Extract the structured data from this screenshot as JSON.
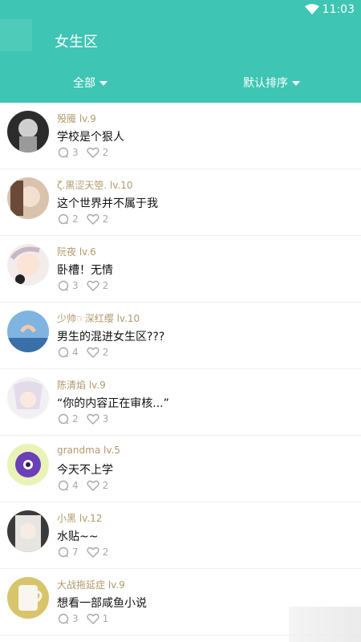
{
  "status_bar": {
    "time": "11:03"
  },
  "header": {
    "title": "女生区",
    "filter_all": "全部",
    "filter_sort": "默认排序"
  },
  "posts": [
    {
      "user": "殁魇 lv.9",
      "title": "学校是个狠人",
      "comments": "3",
      "likes": "2"
    },
    {
      "user": "ζ.黒涩天箜. lv.10",
      "title": "这个世界并不属于我",
      "comments": "2",
      "likes": "2"
    },
    {
      "user": "阮夜 lv.6",
      "title": "卧槽！无情",
      "comments": "3",
      "likes": "2"
    },
    {
      "user": "少帅☞深红缨 lv.10",
      "title": "男生的混进女生区???",
      "comments": "4",
      "likes": "2"
    },
    {
      "user": "陈清焰 lv.9",
      "title": "“你的内容正在审核...”",
      "comments": "2",
      "likes": "3"
    },
    {
      "user": "grandma lv.5",
      "title": "今天不上学",
      "comments": "4",
      "likes": "2"
    },
    {
      "user": "小黑 lv.12",
      "title": "水贴~~",
      "comments": "7",
      "likes": "2"
    },
    {
      "user": "大战拖延症 lv.9",
      "title": "想看一部咸鱼小说",
      "comments": "3",
      "likes": "1"
    }
  ],
  "colors": {
    "accent": "#3ec5b3",
    "username": "#b09a6a"
  }
}
